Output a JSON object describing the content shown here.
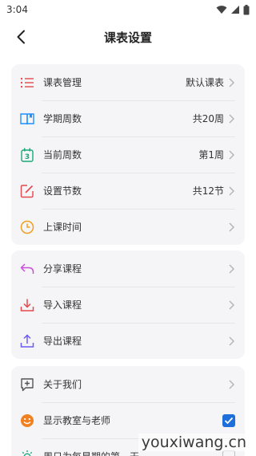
{
  "status_bar": {
    "time": "3:04"
  },
  "header": {
    "title": "课表设置"
  },
  "group1": [
    {
      "label": "课表管理",
      "value": "默认课表",
      "icon": "list-icon",
      "color": "#e5484d"
    },
    {
      "label": "学期周数",
      "value": "共20周",
      "icon": "book-icon",
      "color": "#1e90ff"
    },
    {
      "label": "当前周数",
      "value": "第1周",
      "icon": "calendar-icon",
      "color": "#19a974"
    },
    {
      "label": "设置节数",
      "value": "共12节",
      "icon": "edit-icon",
      "color": "#e5484d"
    },
    {
      "label": "上课时间",
      "value": "",
      "icon": "clock-icon",
      "color": "#f0a020"
    }
  ],
  "group2": [
    {
      "label": "分享课程",
      "icon": "share-icon",
      "color": "#c84fd8"
    },
    {
      "label": "导入课程",
      "icon": "import-icon",
      "color": "#e5484d"
    },
    {
      "label": "导出课程",
      "icon": "export-icon",
      "color": "#6a5cf0"
    }
  ],
  "group3": [
    {
      "label": "关于我们",
      "icon": "about-icon",
      "color": "#555555"
    },
    {
      "label": "显示教室与老师",
      "icon": "smile-icon",
      "color": "#f08020",
      "checked": true
    },
    {
      "label": "周日为每星期的第一天",
      "icon": "sun-icon",
      "color": "#19a974",
      "checked": false
    }
  ],
  "watermark": "youxiwang.cn",
  "colors": {
    "accent": "#1e6fd9",
    "card_bg": "#f5f5f7"
  }
}
